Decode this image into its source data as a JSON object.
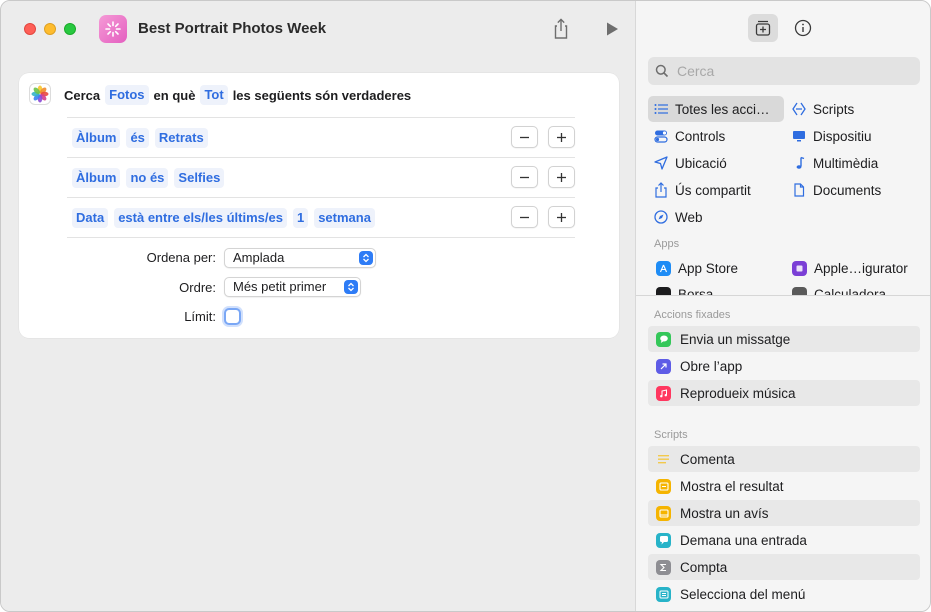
{
  "window": {
    "title": "Best Portrait Photos Week"
  },
  "find_action": {
    "word_find": "Cerca",
    "source_token": "Fotos",
    "word_where": "en què",
    "match_token": "Tot",
    "word_tail": "les següents són verdaderes"
  },
  "filters": [
    {
      "tokens": [
        "Àlbum",
        "és",
        "Retrats"
      ]
    },
    {
      "tokens": [
        "Àlbum",
        "no és",
        "Selfies"
      ]
    },
    {
      "tokens": [
        "Data",
        "està entre els/les últims/es",
        "1",
        "setmana"
      ]
    }
  ],
  "options": {
    "sort_label": "Ordena per:",
    "sort_value": "Amplada",
    "order_label": "Ordre:",
    "order_value": "Més petit primer",
    "limit_label": "Límit:"
  },
  "library": {
    "search_placeholder": "Cerca",
    "categories_left": [
      {
        "label": "Totes les acci…",
        "icon": "list-icon",
        "selected": true
      },
      {
        "label": "Controls",
        "icon": "toggle-icon"
      },
      {
        "label": "Ubicació",
        "icon": "location-arrow-icon"
      },
      {
        "label": "Ús compartit",
        "icon": "share-icon"
      },
      {
        "label": "Web",
        "icon": "compass-icon"
      }
    ],
    "categories_right": [
      {
        "label": "Scripts",
        "icon": "script-icon"
      },
      {
        "label": "Dispositiu",
        "icon": "display-icon"
      },
      {
        "label": "Multimèdia",
        "icon": "music-note-icon"
      },
      {
        "label": "Documents",
        "icon": "document-icon"
      }
    ],
    "apps_header": "Apps",
    "apps": [
      {
        "label": "App Store",
        "color": "#1e8cf5"
      },
      {
        "label": "Apple…igurator",
        "color": "#7b3fd6"
      },
      {
        "label": "Borsa",
        "color": "#1c1c1e"
      },
      {
        "label": "Calculadora",
        "color": "#5a5a5a"
      }
    ],
    "pinned_header": "Accions fixades",
    "pinned": [
      {
        "label": "Envia un missatge",
        "color": "#34c759",
        "icon": "message-icon"
      },
      {
        "label": "Obre l’app",
        "color": "#5e5ce6",
        "icon": "open-app-icon"
      },
      {
        "label": "Reprodueix música",
        "color": "#ff375f",
        "icon": "music-icon"
      }
    ],
    "scripts_header": "Scripts",
    "scripts": [
      {
        "label": "Comenta",
        "color": "#f2c94c",
        "icon": "comment-lines-icon"
      },
      {
        "label": "Mostra el resultat",
        "color": "#f5b400",
        "icon": "show-result-icon"
      },
      {
        "label": "Mostra un avís",
        "color": "#f5b400",
        "icon": "alert-icon"
      },
      {
        "label": "Demana una entrada",
        "color": "#27b3c8",
        "icon": "ask-input-icon"
      },
      {
        "label": "Compta",
        "color": "#8e8e93",
        "icon": "sigma-icon"
      },
      {
        "label": "Selecciona del menú",
        "color": "#27b3c8",
        "icon": "menu-select-icon"
      }
    ]
  }
}
